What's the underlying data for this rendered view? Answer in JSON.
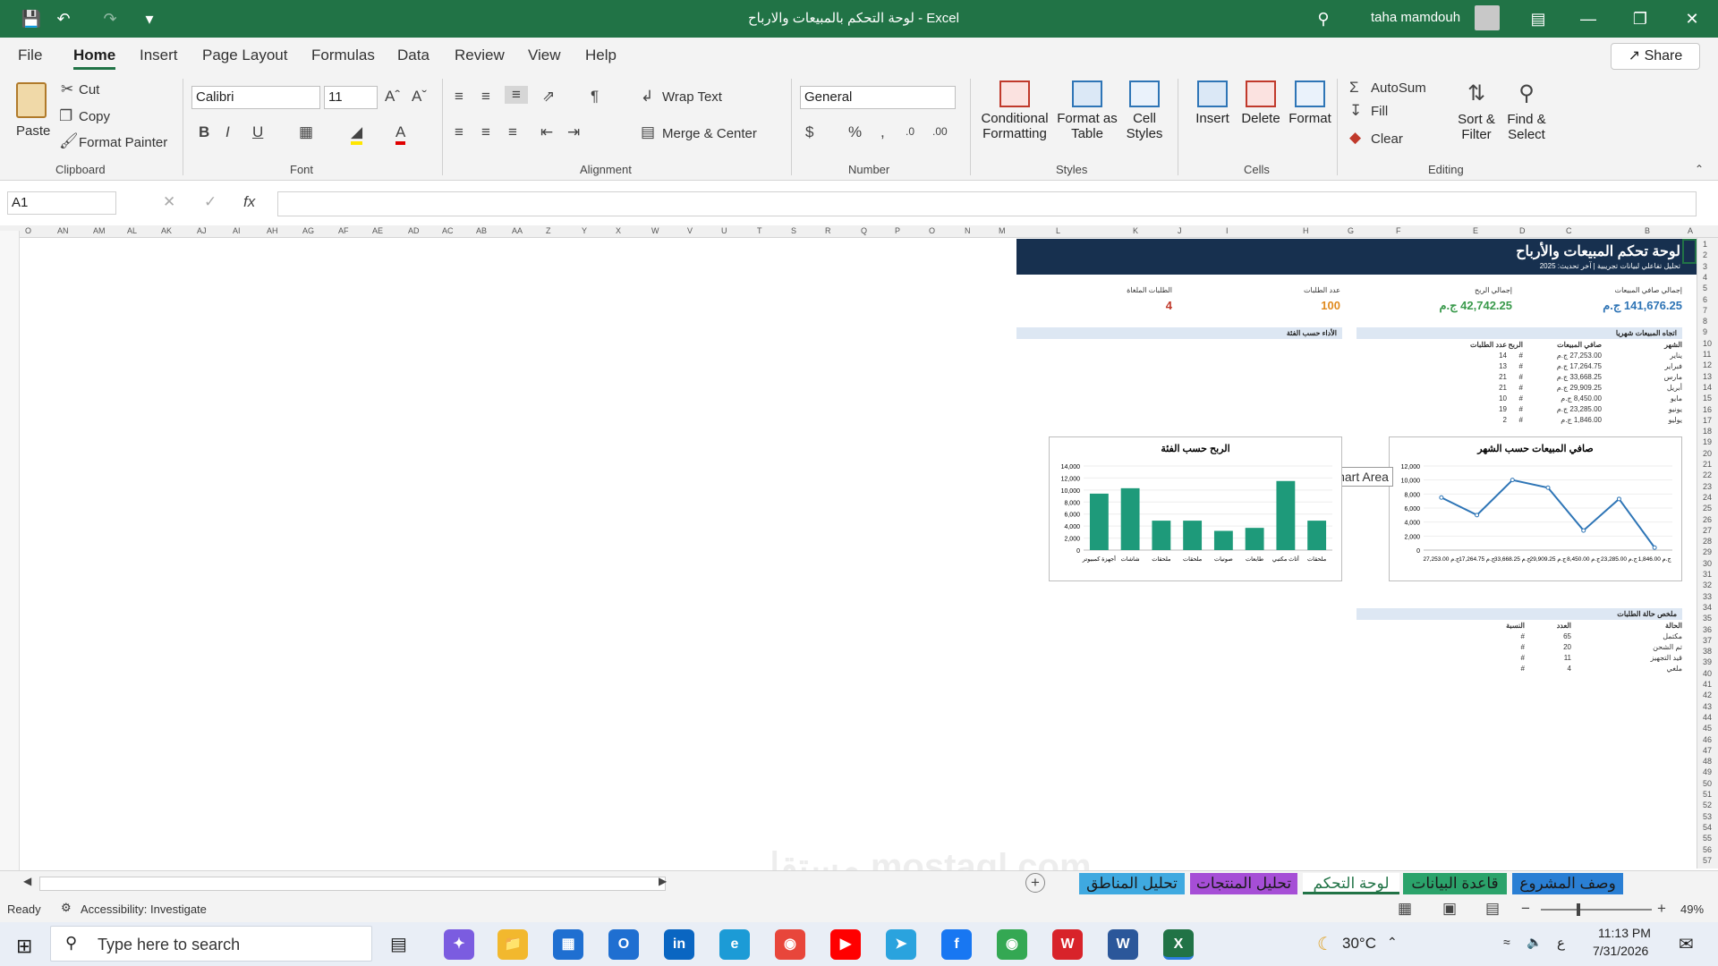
{
  "titlebar": {
    "title": "لوحة التحكم بالمبيعات والارباح  -  Excel",
    "user": "taha mamdouh"
  },
  "menu": [
    "File",
    "Home",
    "Insert",
    "Page Layout",
    "Formulas",
    "Data",
    "Review",
    "View",
    "Help"
  ],
  "share_label": "Share",
  "clipboard": {
    "paste": "Paste",
    "cut": "Cut",
    "copy": "Copy",
    "format_painter": "Format Painter",
    "group": "Clipboard"
  },
  "font": {
    "name": "Calibri",
    "size": "11",
    "group": "Font"
  },
  "alignment": {
    "wrap": "Wrap Text",
    "merge": "Merge & Center",
    "group": "Alignment"
  },
  "number": {
    "format": "General",
    "group": "Number"
  },
  "styles": {
    "cond": "Conditional",
    "cond2": "Formatting",
    "fat": "Format as",
    "fat2": "Table",
    "cell": "Cell",
    "cell2": "Styles",
    "group": "Styles"
  },
  "cells": {
    "insert": "Insert",
    "delete": "Delete",
    "format": "Format",
    "group": "Cells"
  },
  "editing": {
    "autosum": "AutoSum",
    "fill": "Fill",
    "clear": "Clear",
    "sort": "Sort &",
    "sort2": "Filter",
    "find": "Find &",
    "find2": "Select",
    "group": "Editing"
  },
  "formula_bar": {
    "name_box": "A1",
    "fx": "fx"
  },
  "columns": [
    "O",
    "AN",
    "AM",
    "AL",
    "AK",
    "AJ",
    "AI",
    "AH",
    "AG",
    "AF",
    "AE",
    "AD",
    "AC",
    "AB",
    "AA",
    "Z",
    "Y",
    "X",
    "W",
    "V",
    "U",
    "T",
    "S",
    "R",
    "Q",
    "P",
    "O",
    "N",
    "M",
    "L",
    "K",
    "J",
    "I",
    "H",
    "G",
    "F",
    "E",
    "D",
    "C",
    "B",
    "A"
  ],
  "dashboard": {
    "title": "لوحة تحكم المبيعات والأرباح",
    "subtitle": "تحليل تفاعلي لبيانات تجريبية | آخر تحديث: 2025",
    "kpis": [
      {
        "label": "إجمالي صافي المبيعات",
        "value": "141,676.25 ج.م",
        "color": "#2e74b5"
      },
      {
        "label": "إجمالي الربح",
        "value": "42,742.25 ج.م",
        "color": "#3a9a4c"
      },
      {
        "label": "عدد الطلبات",
        "value": "100",
        "color": "#e08a1e"
      },
      {
        "label": "الطلبات الملغاة",
        "value": "4",
        "color": "#c0392b"
      }
    ],
    "monthly_title": "اتجاه المبيعات شهريا",
    "category_title": "الأداء حسب الفئة",
    "monthly_headers": [
      "الشهر",
      "صافي المبيعات",
      "الربح",
      "عدد الطلبات"
    ],
    "monthly_rows": [
      [
        "يناير",
        "27,253.00 ج.م",
        "#",
        "14"
      ],
      [
        "فبراير",
        "17,264.75 ج.م",
        "#",
        "13"
      ],
      [
        "مارس",
        "33,668.25 ج.م",
        "#",
        "21"
      ],
      [
        "أبريل",
        "29,909.25 ج.م",
        "#",
        "21"
      ],
      [
        "مايو",
        "8,450.00 ج.م",
        "#",
        "10"
      ],
      [
        "يونيو",
        "23,285.00 ج.م",
        "#",
        "19"
      ],
      [
        "يوليو",
        "1,846.00 ج.م",
        "#",
        "2"
      ]
    ],
    "status_title": "ملخص حالة الطلبات",
    "status_headers": [
      "الحالة",
      "العدد",
      "النسبة"
    ],
    "status_rows": [
      [
        "مكتمل",
        "65",
        "#"
      ],
      [
        "تم الشحن",
        "20",
        "#"
      ],
      [
        "قيد التجهيز",
        "11",
        "#"
      ],
      [
        "ملغي",
        "4",
        "#"
      ]
    ],
    "tooltip": "Chart Area"
  },
  "chart_data": [
    {
      "type": "line",
      "title": "صافي المبيعات حسب الشهر",
      "categories": [
        "27,253.00 ج.م",
        "17,264.75 ج.م",
        "33,668.25 ج.م",
        "29,909.25 ج.م",
        "8,450.00 ج.م",
        "23,285.00 ج.م",
        "1,846.00 ج.م"
      ],
      "values": [
        7500,
        5000,
        10000,
        8900,
        2800,
        7300,
        350
      ],
      "ylim": [
        0,
        12000
      ],
      "yticks": [
        "0",
        "2,000",
        "4,000",
        "6,000",
        "8,000",
        "10,000",
        "12,000"
      ],
      "color": "#2e75b6"
    },
    {
      "type": "bar",
      "title": "الربح حسب الفئة",
      "categories": [
        "أجهزة كمبيوتر",
        "شاشات",
        "ملحقات",
        "ملحقات",
        "صوتيات",
        "طابعات",
        "أثاث مكتبي",
        "ملحقات"
      ],
      "values": [
        9400,
        10300,
        4900,
        4900,
        3200,
        3700,
        11500,
        4900
      ],
      "ylim": [
        0,
        14000
      ],
      "yticks": [
        "0",
        "2,000",
        "4,000",
        "6,000",
        "8,000",
        "10,000",
        "12,000",
        "14,000"
      ],
      "color": "#1e9a7a"
    }
  ],
  "tabs": [
    {
      "label": "تحليل المناطق",
      "color": "#3fa9e0"
    },
    {
      "label": "تحليل المنتجات",
      "color": "#a64ed6"
    },
    {
      "label": "لوحة التحكم",
      "color": "#ffffff"
    },
    {
      "label": "قاعدة البيانات",
      "color": "#2ba36b"
    },
    {
      "label": "وصف المشروع",
      "color": "#2a7fd4"
    }
  ],
  "status": {
    "ready": "Ready",
    "accessibility": "Accessibility: Investigate",
    "zoom": "49%"
  },
  "taskbar": {
    "search": "Type here to search",
    "temp": "30°C",
    "time": "11:13 PM",
    "date": "7/31/2026",
    "lang": "ع"
  },
  "watermark": "مستقل mostaql.com"
}
